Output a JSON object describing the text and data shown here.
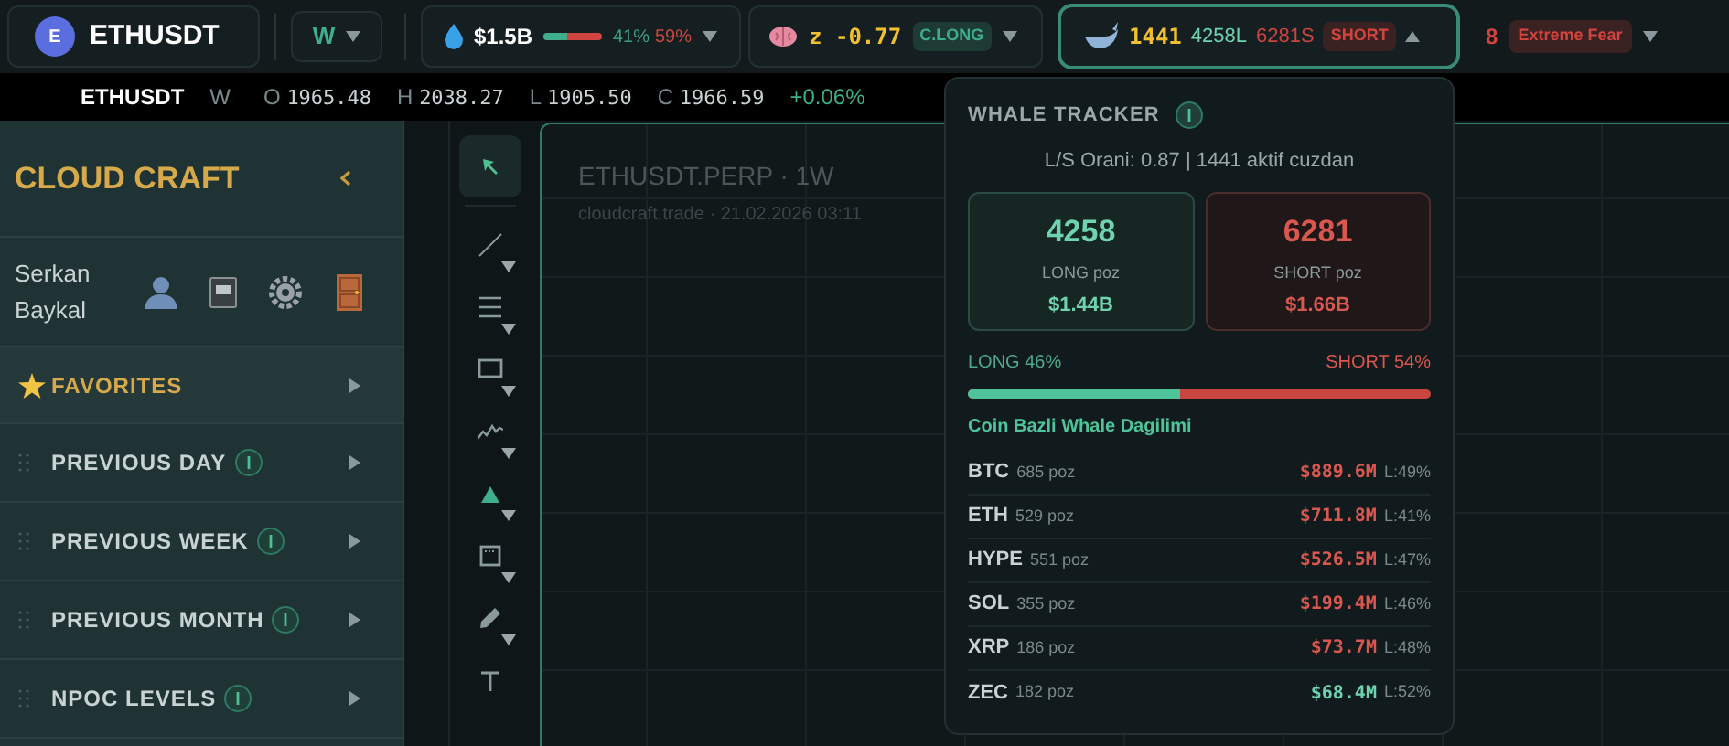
{
  "symbol": {
    "badge": "E",
    "name": "ETHUSDT"
  },
  "interval": {
    "label": "W"
  },
  "liquidity": {
    "value": "$1.5B",
    "level": 0.41,
    "long_pct": "41%",
    "short_pct": "59%"
  },
  "zscore": {
    "label": "z",
    "value": "-0.77",
    "tag": "C.LONG"
  },
  "whale": {
    "count": "1441",
    "long": "4258L",
    "short": "6281S",
    "tag": "SHORT",
    "expanded": true
  },
  "fear": {
    "value": "8",
    "label": "Extreme Fear"
  },
  "ohlc": {
    "symbol": "ETHUSDT",
    "interval": "W",
    "fields": [
      {
        "key": "O",
        "value": "1965.48"
      },
      {
        "key": "H",
        "value": "2038.27"
      },
      {
        "key": "L",
        "value": "1905.50"
      },
      {
        "key": "C",
        "value": "1966.59"
      }
    ],
    "change": "+0.06%"
  },
  "sidebar": {
    "title": "CLOUD CRAFT",
    "user": "Serkan Baykal",
    "items": [
      {
        "label": "FAVORITES",
        "kind": "favorites",
        "selected": true
      },
      {
        "label": "PREVIOUS DAY",
        "kind": "level",
        "selected": false
      },
      {
        "label": "PREVIOUS WEEK",
        "kind": "level",
        "selected": false
      },
      {
        "label": "PREVIOUS MONTH",
        "kind": "level",
        "selected": false
      },
      {
        "label": "NPOC LEVELS",
        "kind": "level",
        "selected": false
      }
    ]
  },
  "tools": [
    {
      "kind": "cursor",
      "selected": true
    },
    {
      "kind": "line",
      "selected": false
    },
    {
      "kind": "hlines",
      "selected": false
    },
    {
      "kind": "rect",
      "selected": false
    },
    {
      "kind": "zigzag",
      "selected": false
    },
    {
      "kind": "triangle",
      "selected": false
    },
    {
      "kind": "calendar",
      "selected": false
    },
    {
      "kind": "pencil",
      "selected": false
    },
    {
      "kind": "text",
      "selected": false
    }
  ],
  "chart": {
    "title": "ETHUSDT.PERP · 1W",
    "subtitle": "cloudcraft.trade · 21.02.2026 03:11"
  },
  "whale_tracker": {
    "title": "WHALE TRACKER",
    "ratio_line": "L/S Orani: 0.87 | 1441 aktif cuzdan",
    "long_card": {
      "count": "4258",
      "label": "LONG poz",
      "value": "$1.44B"
    },
    "short_card": {
      "count": "6281",
      "label": "SHORT poz",
      "value": "$1.66B"
    },
    "long_label": "LONG 46%",
    "short_label": "SHORT 54%",
    "level": 0.46,
    "section_title": "Coin Bazli Whale Dagilimi",
    "coins": [
      {
        "symbol": "BTC",
        "positions": "685 poz",
        "value": "$889.6M",
        "ratio": "L:49%",
        "kind": "short"
      },
      {
        "symbol": "ETH",
        "positions": "529 poz",
        "value": "$711.8M",
        "ratio": "L:41%",
        "kind": "short"
      },
      {
        "symbol": "HYPE",
        "positions": "551 poz",
        "value": "$526.5M",
        "ratio": "L:47%",
        "kind": "short"
      },
      {
        "symbol": "SOL",
        "positions": "355 poz",
        "value": "$199.4M",
        "ratio": "L:46%",
        "kind": "short"
      },
      {
        "symbol": "XRP",
        "positions": "186 poz",
        "value": "$73.7M",
        "ratio": "L:48%",
        "kind": "short"
      },
      {
        "symbol": "ZEC",
        "positions": "182 poz",
        "value": "$68.4M",
        "ratio": "L:52%",
        "kind": "long"
      }
    ]
  }
}
